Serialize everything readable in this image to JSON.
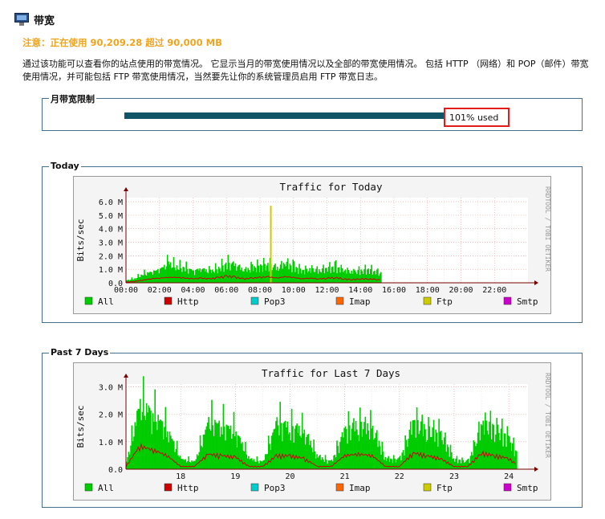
{
  "header": {
    "title": "带宽",
    "icon": "monitor-icon"
  },
  "notice": "注意：正在使用 90,209.28 超过 90,000 MB",
  "description": "通过该功能可以查看你的站点使用的带宽情况。 它显示当月的带宽使用情况以及全部的带宽使用情况。 包括 HTTP （网络）和 POP（邮件）带宽使用情况，并可能包括 FTP 带宽使用情况，当然要先让你的系统管理员启用 FTP 带宽日志。",
  "monthly": {
    "label": "月带宽限制",
    "used_text": "101% used",
    "used_fraction": 1.01,
    "bar_color": "#0f5567",
    "highlight_color": "#e21b1b"
  },
  "today": {
    "label": "Today"
  },
  "week": {
    "label": "Past 7 Days"
  },
  "legend": [
    {
      "name": "All",
      "color": "#00cc00"
    },
    {
      "name": "Http",
      "color": "#cc0000"
    },
    {
      "name": "Pop3",
      "color": "#00cccc"
    },
    {
      "name": "Imap",
      "color": "#ff6600"
    },
    {
      "name": "Ftp",
      "color": "#cccc00"
    },
    {
      "name": "Smtp",
      "color": "#cc00cc"
    }
  ],
  "watermark": "RRDTOOL / TOBI OETIKER",
  "chart_data": [
    {
      "type": "area",
      "title": "Traffic for Today",
      "ylabel": "Bits/sec",
      "xlabel": "",
      "y_ticks": [
        "0.0",
        "1.0 M",
        "2.0 M",
        "3.0 M",
        "4.0 M",
        "5.0 M",
        "6.0 M"
      ],
      "ylim": [
        0,
        6.3
      ],
      "x_ticks": [
        "00:00",
        "02:00",
        "04:00",
        "06:00",
        "08:00",
        "10:00",
        "12:00",
        "14:00",
        "16:00",
        "18:00",
        "20:00",
        "22:00"
      ],
      "xlim": [
        0,
        24
      ],
      "grid": true,
      "x": [
        0,
        0.5,
        1,
        1.5,
        2,
        2.5,
        3,
        3.5,
        4,
        4.5,
        5,
        5.5,
        6,
        6.5,
        7,
        7.5,
        8,
        8.5,
        9,
        9.5,
        10,
        10.5,
        11,
        11.5,
        12,
        12.5,
        13,
        13.5,
        14,
        14.5,
        15,
        15.25
      ],
      "series": [
        {
          "name": "All",
          "values": [
            0.2,
            0.35,
            0.7,
            0.9,
            1.1,
            1.6,
            1.3,
            1.2,
            1.0,
            1.1,
            0.9,
            1.2,
            1.6,
            1.5,
            1.0,
            1.2,
            1.4,
            1.5,
            1.2,
            1.6,
            1.3,
            1.0,
            1.1,
            1.0,
            1.2,
            1.3,
            1.0,
            0.9,
            1.0,
            1.1,
            0.8,
            0.8
          ]
        },
        {
          "name": "Http",
          "values": [
            0.05,
            0.1,
            0.2,
            0.3,
            0.35,
            0.4,
            0.4,
            0.35,
            0.3,
            0.35,
            0.3,
            0.4,
            0.5,
            0.45,
            0.3,
            0.35,
            0.4,
            0.45,
            0.35,
            0.45,
            0.4,
            0.3,
            0.35,
            0.3,
            0.35,
            0.4,
            0.3,
            0.25,
            0.3,
            0.3,
            0.25,
            0.25
          ]
        },
        {
          "name": "Ftp",
          "spike_x": 8.6,
          "spike_value": 5.7
        }
      ]
    },
    {
      "type": "area",
      "title": "Traffic for Last 7 Days",
      "ylabel": "Bits/sec",
      "xlabel": "",
      "y_ticks": [
        "0.0",
        "1.0 M",
        "2.0 M",
        "3.0 M"
      ],
      "ylim": [
        0,
        3.1
      ],
      "x_ticks": [
        "18",
        "19",
        "20",
        "21",
        "22",
        "23",
        "24"
      ],
      "xlim": [
        17.0,
        24.35
      ],
      "grid": true,
      "x": [
        17.0,
        17.25,
        17.5,
        17.75,
        18.0,
        18.25,
        18.5,
        18.75,
        19.0,
        19.25,
        19.5,
        19.75,
        20.0,
        20.25,
        20.5,
        20.75,
        21.0,
        21.25,
        21.5,
        21.75,
        22.0,
        22.25,
        22.5,
        22.75,
        23.0,
        23.25,
        23.5,
        23.75,
        24.0,
        24.15
      ],
      "series": [
        {
          "name": "All",
          "values": [
            0.3,
            2.6,
            2.2,
            1.6,
            0.4,
            0.3,
            1.9,
            1.8,
            1.5,
            0.4,
            0.3,
            1.9,
            1.7,
            1.5,
            0.5,
            0.3,
            1.6,
            1.8,
            1.6,
            0.4,
            0.4,
            1.9,
            1.6,
            1.4,
            0.4,
            0.3,
            1.8,
            1.7,
            1.2,
            0.6
          ]
        },
        {
          "name": "Http",
          "values": [
            0.1,
            0.85,
            0.7,
            0.5,
            0.1,
            0.1,
            0.55,
            0.5,
            0.45,
            0.1,
            0.1,
            0.5,
            0.5,
            0.4,
            0.1,
            0.1,
            0.5,
            0.55,
            0.5,
            0.1,
            0.1,
            0.6,
            0.5,
            0.4,
            0.1,
            0.1,
            0.6,
            0.5,
            0.4,
            0.15
          ]
        }
      ]
    }
  ]
}
